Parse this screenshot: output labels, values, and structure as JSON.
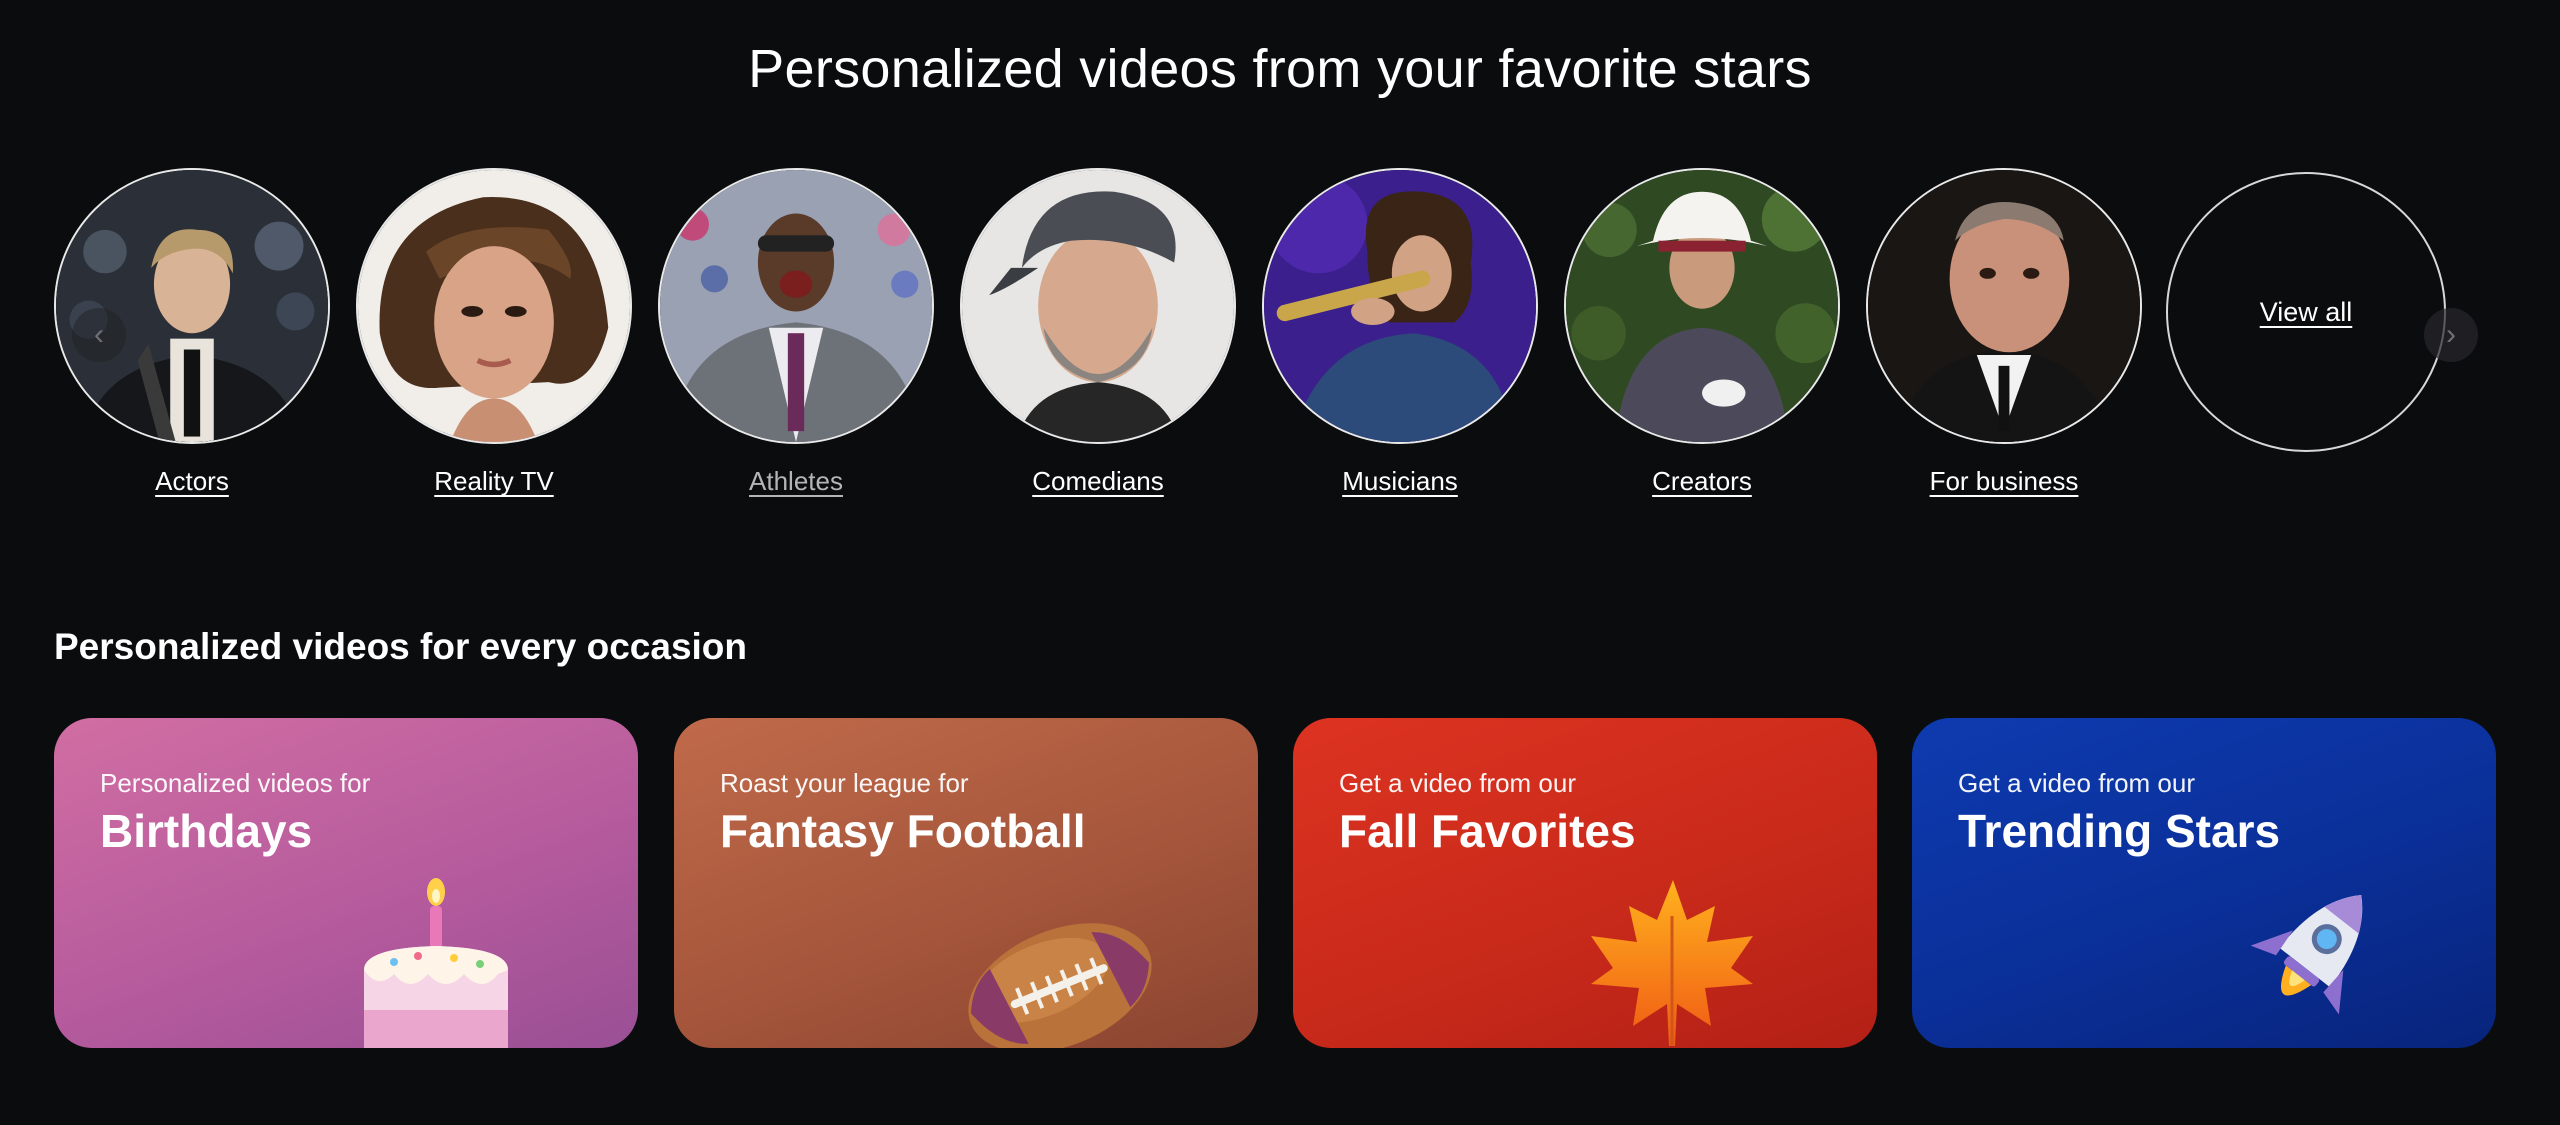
{
  "hero": {
    "title": "Personalized videos from your favorite stars"
  },
  "categories": [
    {
      "label": "Actors"
    },
    {
      "label": "Reality TV"
    },
    {
      "label": "Athletes"
    },
    {
      "label": "Comedians"
    },
    {
      "label": "Musicians"
    },
    {
      "label": "Creators"
    },
    {
      "label": "For business"
    }
  ],
  "view_all": {
    "label": "View all"
  },
  "carousel_controls": {
    "prev_icon": "chevron-left-icon",
    "next_icon": "chevron-right-icon"
  },
  "occasions": {
    "title": "Personalized videos for every occasion",
    "cards": [
      {
        "eyebrow": "Personalized videos for",
        "headline": "Birthdays",
        "icon": "birthday-cake-icon",
        "color": "#c8629f"
      },
      {
        "eyebrow": "Roast your league for",
        "headline": "Fantasy Football",
        "icon": "football-icon",
        "color": "#b05a3c"
      },
      {
        "eyebrow": "Get a video from our",
        "headline": "Fall Favorites",
        "icon": "maple-leaf-icon",
        "color": "#d42a1c"
      },
      {
        "eyebrow": "Get a video from our",
        "headline": "Trending Stars",
        "icon": "rocket-icon",
        "color": "#0a2f9e"
      }
    ]
  }
}
